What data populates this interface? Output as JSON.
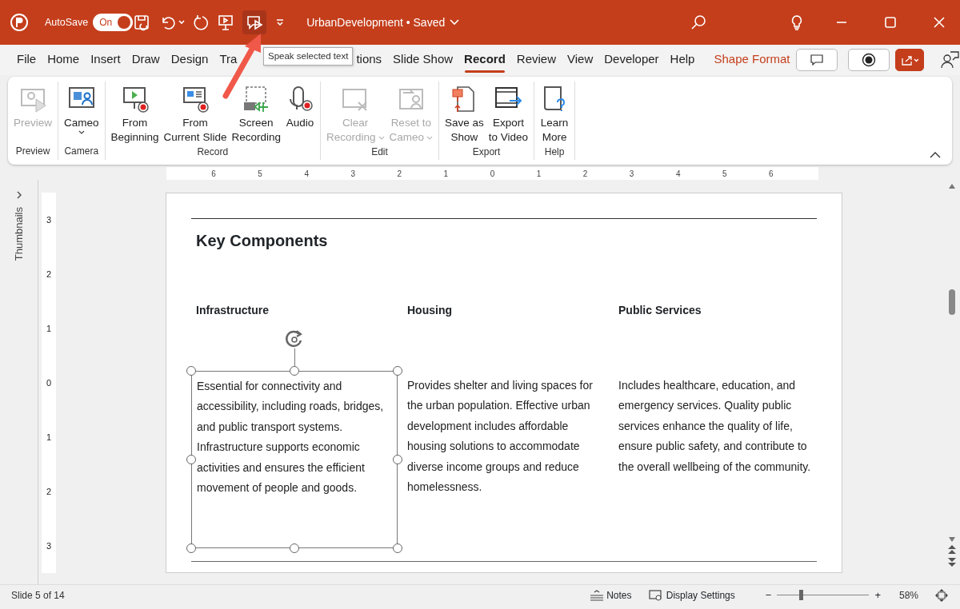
{
  "title_bar": {
    "autosave_label": "AutoSave",
    "autosave": {
      "label": "On",
      "on": true
    },
    "document_title": "UrbanDevelopment • Saved"
  },
  "tooltip": "Speak selected text",
  "tabs": [
    {
      "label": "File",
      "selected": false,
      "kind": "normal"
    },
    {
      "label": "Home",
      "selected": false,
      "kind": "normal"
    },
    {
      "label": "Insert",
      "selected": false,
      "kind": "normal"
    },
    {
      "label": "Draw",
      "selected": false,
      "kind": "normal"
    },
    {
      "label": "Design",
      "selected": false,
      "kind": "normal"
    },
    {
      "label": "Tra",
      "selected": false,
      "kind": "covered"
    },
    {
      "label": "tions",
      "selected": false,
      "kind": "normal"
    },
    {
      "label": "Slide Show",
      "selected": false,
      "kind": "normal"
    },
    {
      "label": "Record",
      "selected": true,
      "kind": "normal"
    },
    {
      "label": "Review",
      "selected": false,
      "kind": "normal"
    },
    {
      "label": "View",
      "selected": false,
      "kind": "normal"
    },
    {
      "label": "Developer",
      "selected": false,
      "kind": "normal"
    },
    {
      "label": "Help",
      "selected": false,
      "kind": "normal"
    },
    {
      "label": "Shape Format",
      "selected": false,
      "kind": "contextual"
    }
  ],
  "ribbon_groups": [
    {
      "label": "Preview",
      "buttons": [
        {
          "lines": [
            "Preview"
          ],
          "disabled": true,
          "dropdown": false
        }
      ]
    },
    {
      "label": "Camera",
      "buttons": [
        {
          "lines": [
            "Cameo"
          ],
          "disabled": false,
          "dropdown": true
        }
      ]
    },
    {
      "label": "Record",
      "buttons": [
        {
          "lines": [
            "From",
            "Beginning"
          ],
          "disabled": false,
          "dropdown": false
        },
        {
          "lines": [
            "From",
            "Current Slide"
          ],
          "disabled": false,
          "dropdown": false
        },
        {
          "lines": [
            "Screen",
            "Recording"
          ],
          "disabled": false,
          "dropdown": false
        },
        {
          "lines": [
            "Audio"
          ],
          "disabled": false,
          "dropdown": false
        }
      ]
    },
    {
      "label": "Edit",
      "buttons": [
        {
          "lines": [
            "Clear",
            "Recording"
          ],
          "disabled": true,
          "dropdown": true
        },
        {
          "lines": [
            "Reset to",
            "Cameo"
          ],
          "disabled": true,
          "dropdown": true
        }
      ]
    },
    {
      "label": "Export",
      "buttons": [
        {
          "lines": [
            "Save as",
            "Show"
          ],
          "disabled": false,
          "dropdown": false
        },
        {
          "lines": [
            "Export",
            "to Video"
          ],
          "disabled": false,
          "dropdown": false
        }
      ]
    },
    {
      "label": "Help",
      "buttons": [
        {
          "lines": [
            "Learn",
            "More"
          ],
          "disabled": false,
          "dropdown": false
        }
      ]
    }
  ],
  "side_panel": {
    "label": "Thumbnails"
  },
  "horizontal_ruler": [
    "6",
    "5",
    "4",
    "3",
    "2",
    "1",
    "0",
    "1",
    "2",
    "3",
    "4",
    "5",
    "6"
  ],
  "vertical_ruler": [
    "3",
    "2",
    "1",
    "0",
    "1",
    "2",
    "3"
  ],
  "slide": {
    "title": "Key Components",
    "columns": [
      {
        "heading": "Infrastructure",
        "body": "Essential for connectivity and accessibility, including roads, bridges, and public transport systems. Infrastructure supports economic activities and ensures the efficient movement of people and goods.",
        "selected": true
      },
      {
        "heading": "Housing",
        "body": "Provides shelter and living spaces for the urban population. Effective urban development includes affordable housing solutions to accommodate diverse income groups and reduce homelessness.",
        "selected": false
      },
      {
        "heading": "Public Services",
        "body": "Includes healthcare, education, and emergency services. Quality public services enhance the quality of life, ensure public safety, and contribute to the overall wellbeing of the community.",
        "selected": false
      }
    ]
  },
  "status_bar": {
    "slide_indicator": "Slide 5 of 14",
    "notes": "Notes",
    "display_settings": "Display Settings",
    "zoom": {
      "minus": "−",
      "plus": "+",
      "level": 0.26,
      "percent": "58%"
    }
  }
}
